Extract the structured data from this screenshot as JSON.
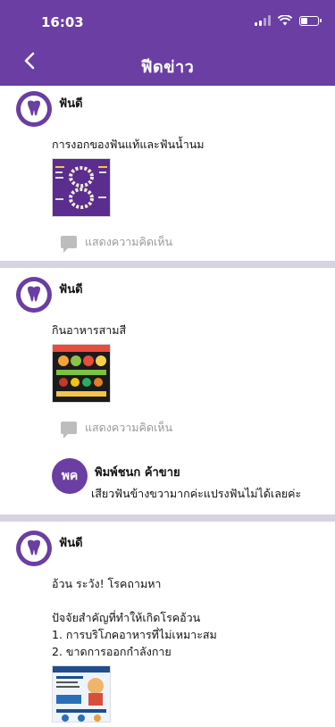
{
  "status": {
    "time": "16:03"
  },
  "header": {
    "title": "ฟีดข่าว"
  },
  "posts": [
    {
      "author": "ฟันดี",
      "text": "การงอกของฟันแท้และฟันน้ำนม",
      "image_icon": "teeth-chart-image",
      "comment_label": "แสดงความคิดเห็น"
    },
    {
      "author": "ฟันดี",
      "text": "กินอาหารสามสี",
      "image_icon": "food-infographic-image",
      "comment_label": "แสดงความคิดเห็น",
      "comments": [
        {
          "initials": "พค",
          "name": "พิมพ์ชนก ค้าขาย",
          "text": "เสียวฟันข้างขวามากค่ะแปรงฟันไม่ได้เลยค่ะ"
        }
      ]
    },
    {
      "author": "ฟันดี",
      "text": "อ้วน ระวัง! โรคถามหา\n\nปัจจัยสำคัญที่ทำให้เกิดโรคอ้วน\n1. การบริโภคอาหารที่ไม่เหมาะสม\n2. ขาดการออกกำลังกาย",
      "image_icon": "obesity-infographic-image"
    }
  ],
  "colors": {
    "brand": "#6a3ea3",
    "divider": "#d8d3e0"
  }
}
